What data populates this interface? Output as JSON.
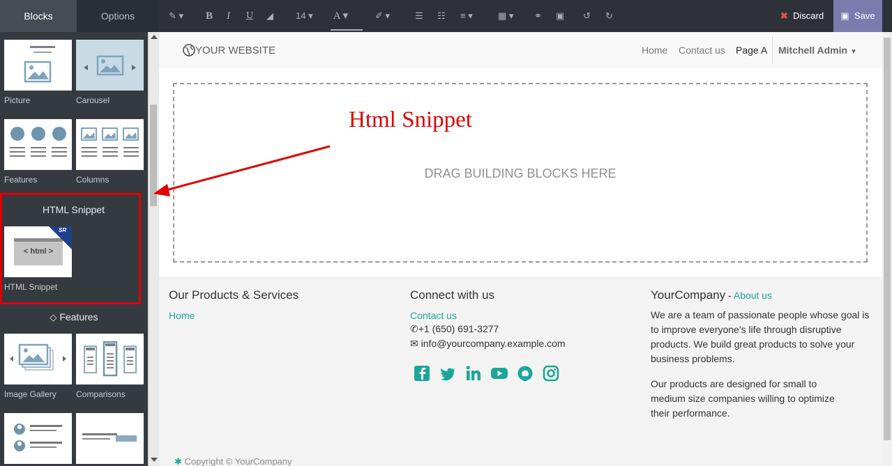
{
  "panel": {
    "tabs": [
      "Blocks",
      "Options"
    ],
    "blocks": {
      "picture": "Picture",
      "carousel": "Carousel",
      "features": "Features",
      "columns": "Columns",
      "html_snippet_section": "HTML Snippet",
      "html_snippet_thumb": "< html >",
      "html_snippet_badge": "SR",
      "html_snippet": "HTML Snippet",
      "features_section": "Features",
      "image_gallery": "Image Gallery",
      "comparisons": "Comparisons"
    }
  },
  "toolbar": {
    "font_size": "14",
    "discard": "Discard",
    "save": "Save"
  },
  "site": {
    "logo": "YOUR WEBSITE",
    "nav": [
      "Home",
      "Contact us",
      "Page A",
      "Mitchell Admin"
    ],
    "drop_message": "DRAG BUILDING BLOCKS HERE",
    "annotation": "Html Snippet"
  },
  "footer": {
    "products_title": "Our Products & Services",
    "products_link": "Home",
    "connect_title": "Connect with us",
    "contact_link": "Contact us",
    "phone": "+1 (650) 691-3277",
    "email": "info@yourcompany.example.com",
    "company_name": "YourCompany",
    "company_sep": " - ",
    "about_link": "About us",
    "about_p1": "We are a team of passionate people whose goal is to improve everyone's life through disruptive products. We build great products to solve your business problems.",
    "about_p2": "Our products are designed for small to medium size companies willing to optimize their performance.",
    "copyright": "Copyright © YourCompany"
  },
  "colors": {
    "accent": "#1ea59a",
    "save": "#7c7bad",
    "highlight": "#e00000",
    "panel": "#343a40"
  }
}
